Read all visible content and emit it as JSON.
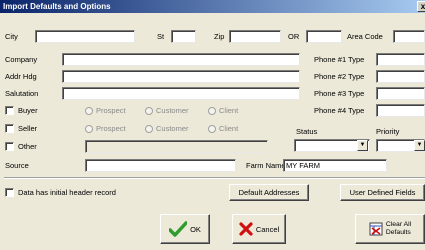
{
  "window": {
    "title": "Import Defaults and Options",
    "close": "x"
  },
  "row1": {
    "city": "City",
    "st": "St",
    "zip": "Zip",
    "or": "OR",
    "area_code": "Area Code"
  },
  "fields": {
    "company": "Company",
    "addr_hdg": "Addr Hdg",
    "salutation": "Salutation",
    "source": "Source",
    "farm_name": "Farm Name",
    "farm_name_value": "MY FARM"
  },
  "phones": [
    "Phone #1 Type",
    "Phone #2 Type",
    "Phone #3 Type",
    "Phone #4 Type"
  ],
  "roles": {
    "buyer": "Buyer",
    "seller": "Seller",
    "other": "Other"
  },
  "radios": {
    "prospect": "Prospect",
    "customer": "Customer",
    "client": "Client"
  },
  "status": {
    "label": "Status",
    "priority": "Priority"
  },
  "options": {
    "header_record": "Data has initial header record"
  },
  "buttons": {
    "default_addresses": "Default Addresses",
    "user_defined_fields": "User Defined Fields",
    "ok": "OK",
    "cancel": "Cancel",
    "clear_all": "Clear All",
    "defaults": "Defaults"
  },
  "colors": {
    "titlebar": "#0a246a",
    "dialog_bg": "#ece9d8",
    "ok_check": "#2e9c2e",
    "cancel_x": "#d01010"
  },
  "icons": {
    "ok": "checkmark-icon",
    "cancel": "x-icon",
    "clear": "clear-defaults-icon",
    "dropdown": "dropdown-arrow"
  }
}
